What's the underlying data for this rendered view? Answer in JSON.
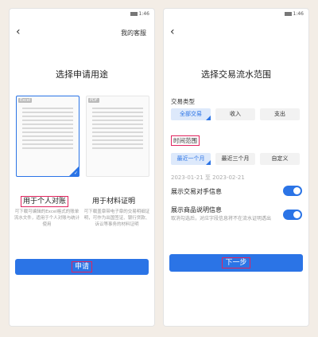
{
  "screen1": {
    "status_time": "1:46",
    "back_icon": "chevron-left",
    "service": "我的客服",
    "title": "选择申请用途",
    "options": [
      {
        "tag": "Excel",
        "label": "用于个人对账",
        "desc": "可下载可编辑的Excel格式的账单流水文件，适用于个人对账与统计使用",
        "selected": true
      },
      {
        "tag": "PDF",
        "label": "用于材料证明",
        "desc": "可下载盖章带电子章的交易明细证明，可作为出国签证、银行贷款、诉讼等事务的材料证明",
        "selected": false
      }
    ],
    "button": "申请"
  },
  "screen2": {
    "status_time": "1:46",
    "back_icon": "chevron-left",
    "title": "选择交易流水范围",
    "type_label": "交易类型",
    "type_chips": [
      "全部交易",
      "收入",
      "支出"
    ],
    "time_label": "时间范围",
    "time_chips": [
      "最近一个月",
      "最近三个月",
      "自定义"
    ],
    "date_range": "2023-01-21 至 2023-02-21",
    "toggle1_label": "展示交易对手信息",
    "toggle2_label": "展示商品说明信息",
    "toggle2_desc": "取消勾选后，对应字段信息将不在流水证明透出",
    "button": "下一步"
  },
  "colors": {
    "accent": "#2b74e6",
    "highlight": "#e0245e"
  }
}
